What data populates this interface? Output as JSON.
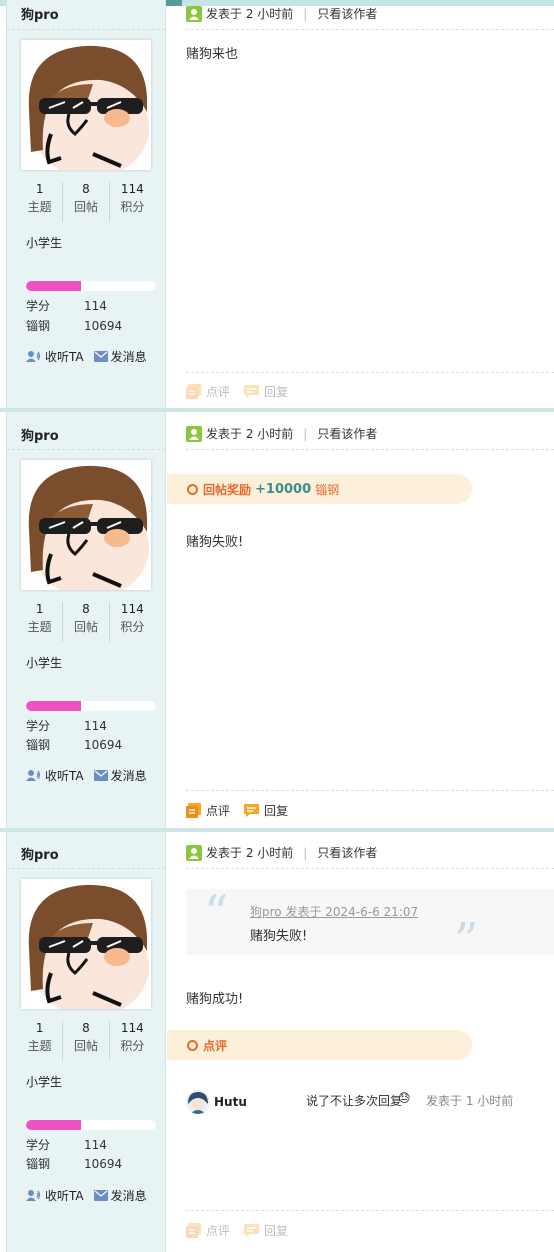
{
  "colors": {
    "accent": "#5a9a9a",
    "sidebar_bg": "#e8f3f3",
    "level_bar": "#f051c2",
    "reward_orange": "#e8692e",
    "reward_value": "#3a8f8a"
  },
  "posts": [
    {
      "username": "狗pro",
      "stats": [
        {
          "num": "1",
          "label": "主题"
        },
        {
          "num": "8",
          "label": "回帖"
        },
        {
          "num": "114",
          "label": "积分"
        }
      ],
      "rank": "小学生",
      "level_progress": 0.42,
      "kv": [
        {
          "k": "学分",
          "v": "114"
        },
        {
          "k": "锱钢",
          "v": "10694"
        }
      ],
      "follow": "收听TA",
      "message": "发消息",
      "posted": "发表于 2 小时前",
      "only_author": "只看该作者",
      "content": "赌狗来也",
      "footer": {
        "rate": "点评",
        "reply": "回复"
      }
    },
    {
      "username": "狗pro",
      "stats": [
        {
          "num": "1",
          "label": "主题"
        },
        {
          "num": "8",
          "label": "回帖"
        },
        {
          "num": "114",
          "label": "积分"
        }
      ],
      "rank": "小学生",
      "level_progress": 0.42,
      "kv": [
        {
          "k": "学分",
          "v": "114"
        },
        {
          "k": "锱钢",
          "v": "10694"
        }
      ],
      "follow": "收听TA",
      "message": "发消息",
      "posted": "发表于 2 小时前",
      "only_author": "只看该作者",
      "reward": {
        "label": "回帖奖励",
        "value": "+10000",
        "unit": "锱钢"
      },
      "content": "赌狗失败!",
      "footer": {
        "rate": "点评",
        "reply": "回复"
      }
    },
    {
      "username": "狗pro",
      "stats": [
        {
          "num": "1",
          "label": "主题"
        },
        {
          "num": "8",
          "label": "回帖"
        },
        {
          "num": "114",
          "label": "积分"
        }
      ],
      "rank": "小学生",
      "level_progress": 0.42,
      "kv": [
        {
          "k": "学分",
          "v": "114"
        },
        {
          "k": "锱钢",
          "v": "10694"
        }
      ],
      "follow": "收听TA",
      "message": "发消息",
      "posted": "发表于 2 小时前",
      "only_author": "只看该作者",
      "quote": {
        "header": "狗pro 发表于 2024-6-6 21:07",
        "text": "赌狗失败!"
      },
      "content": "赌狗成功!",
      "comment_label": "点评",
      "comment": {
        "user": "Hutu",
        "text": "说了不让多次回复",
        "emoji": "😓",
        "time": "发表于 1 小时前"
      },
      "footer": {
        "rate": "点评",
        "reply": "回复"
      }
    }
  ]
}
